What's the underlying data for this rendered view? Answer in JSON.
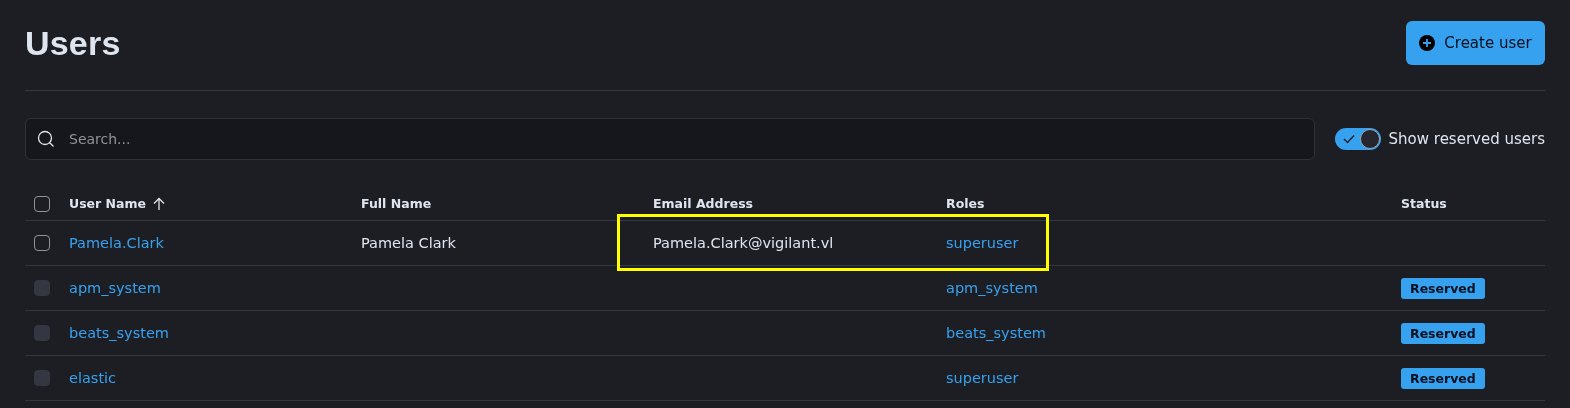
{
  "title": "Users",
  "create_button": {
    "label": "Create user"
  },
  "search": {
    "placeholder": "Search..."
  },
  "reserved_toggle": {
    "label": "Show reserved users",
    "on": true
  },
  "table": {
    "select_all": {
      "checked": false
    },
    "columns": [
      {
        "label": "User Name",
        "sorted": true
      },
      {
        "label": "Full Name",
        "sorted": false
      },
      {
        "label": "Email Address",
        "sorted": false
      },
      {
        "label": "Roles",
        "sorted": false
      },
      {
        "label": "Status",
        "sorted": false
      }
    ],
    "rows": [
      {
        "user_name": "Pamela.Clark",
        "full_name": "Pamela Clark",
        "email": "Pamela.Clark@vigilant.vl",
        "roles": "superuser",
        "disabled": false,
        "checked": false,
        "highlighted": true
      },
      {
        "user_name": "apm_system",
        "roles": "apm_system",
        "status": "Reserved",
        "disabled": true,
        "checked": false,
        "highlighted": false
      },
      {
        "user_name": "beats_system",
        "roles": "beats_system",
        "status": "Reserved",
        "disabled": true,
        "checked": false,
        "highlighted": false
      },
      {
        "user_name": "elastic",
        "roles": "superuser",
        "status": "Reserved",
        "disabled": true,
        "checked": false,
        "highlighted": false
      }
    ]
  }
}
